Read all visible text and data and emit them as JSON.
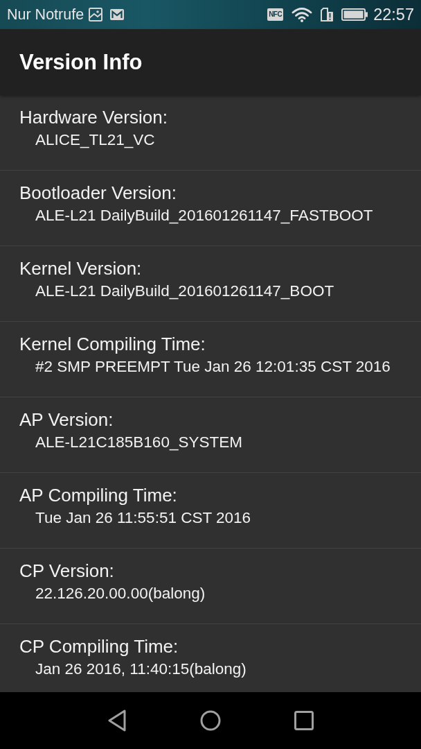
{
  "status_bar": {
    "notification_text": "Nur Notrufe",
    "nfc_badge": "NFC",
    "time": "22:57"
  },
  "app_bar": {
    "title": "Version Info"
  },
  "items": [
    {
      "label": "Hardware Version:",
      "value": "ALICE_TL21_VC"
    },
    {
      "label": "Bootloader Version:",
      "value": "ALE-L21 DailyBuild_201601261147_FASTBOOT"
    },
    {
      "label": "Kernel Version:",
      "value": "ALE-L21 DailyBuild_201601261147_BOOT"
    },
    {
      "label": "Kernel Compiling Time:",
      "value": "#2 SMP PREEMPT Tue Jan 26 12:01:35 CST 2016"
    },
    {
      "label": "AP Version:",
      "value": "ALE-L21C185B160_SYSTEM"
    },
    {
      "label": "AP Compiling Time:",
      "value": "Tue Jan 26 11:55:51 CST 2016"
    },
    {
      "label": "CP Version:",
      "value": "22.126.20.00.00(balong)"
    },
    {
      "label": "CP Compiling Time:",
      "value": "Jan 26 2016, 11:40:15(balong)"
    }
  ],
  "nav_bar": {
    "buttons": [
      {
        "kind": "back"
      },
      {
        "kind": "home"
      },
      {
        "kind": "recents"
      }
    ]
  }
}
